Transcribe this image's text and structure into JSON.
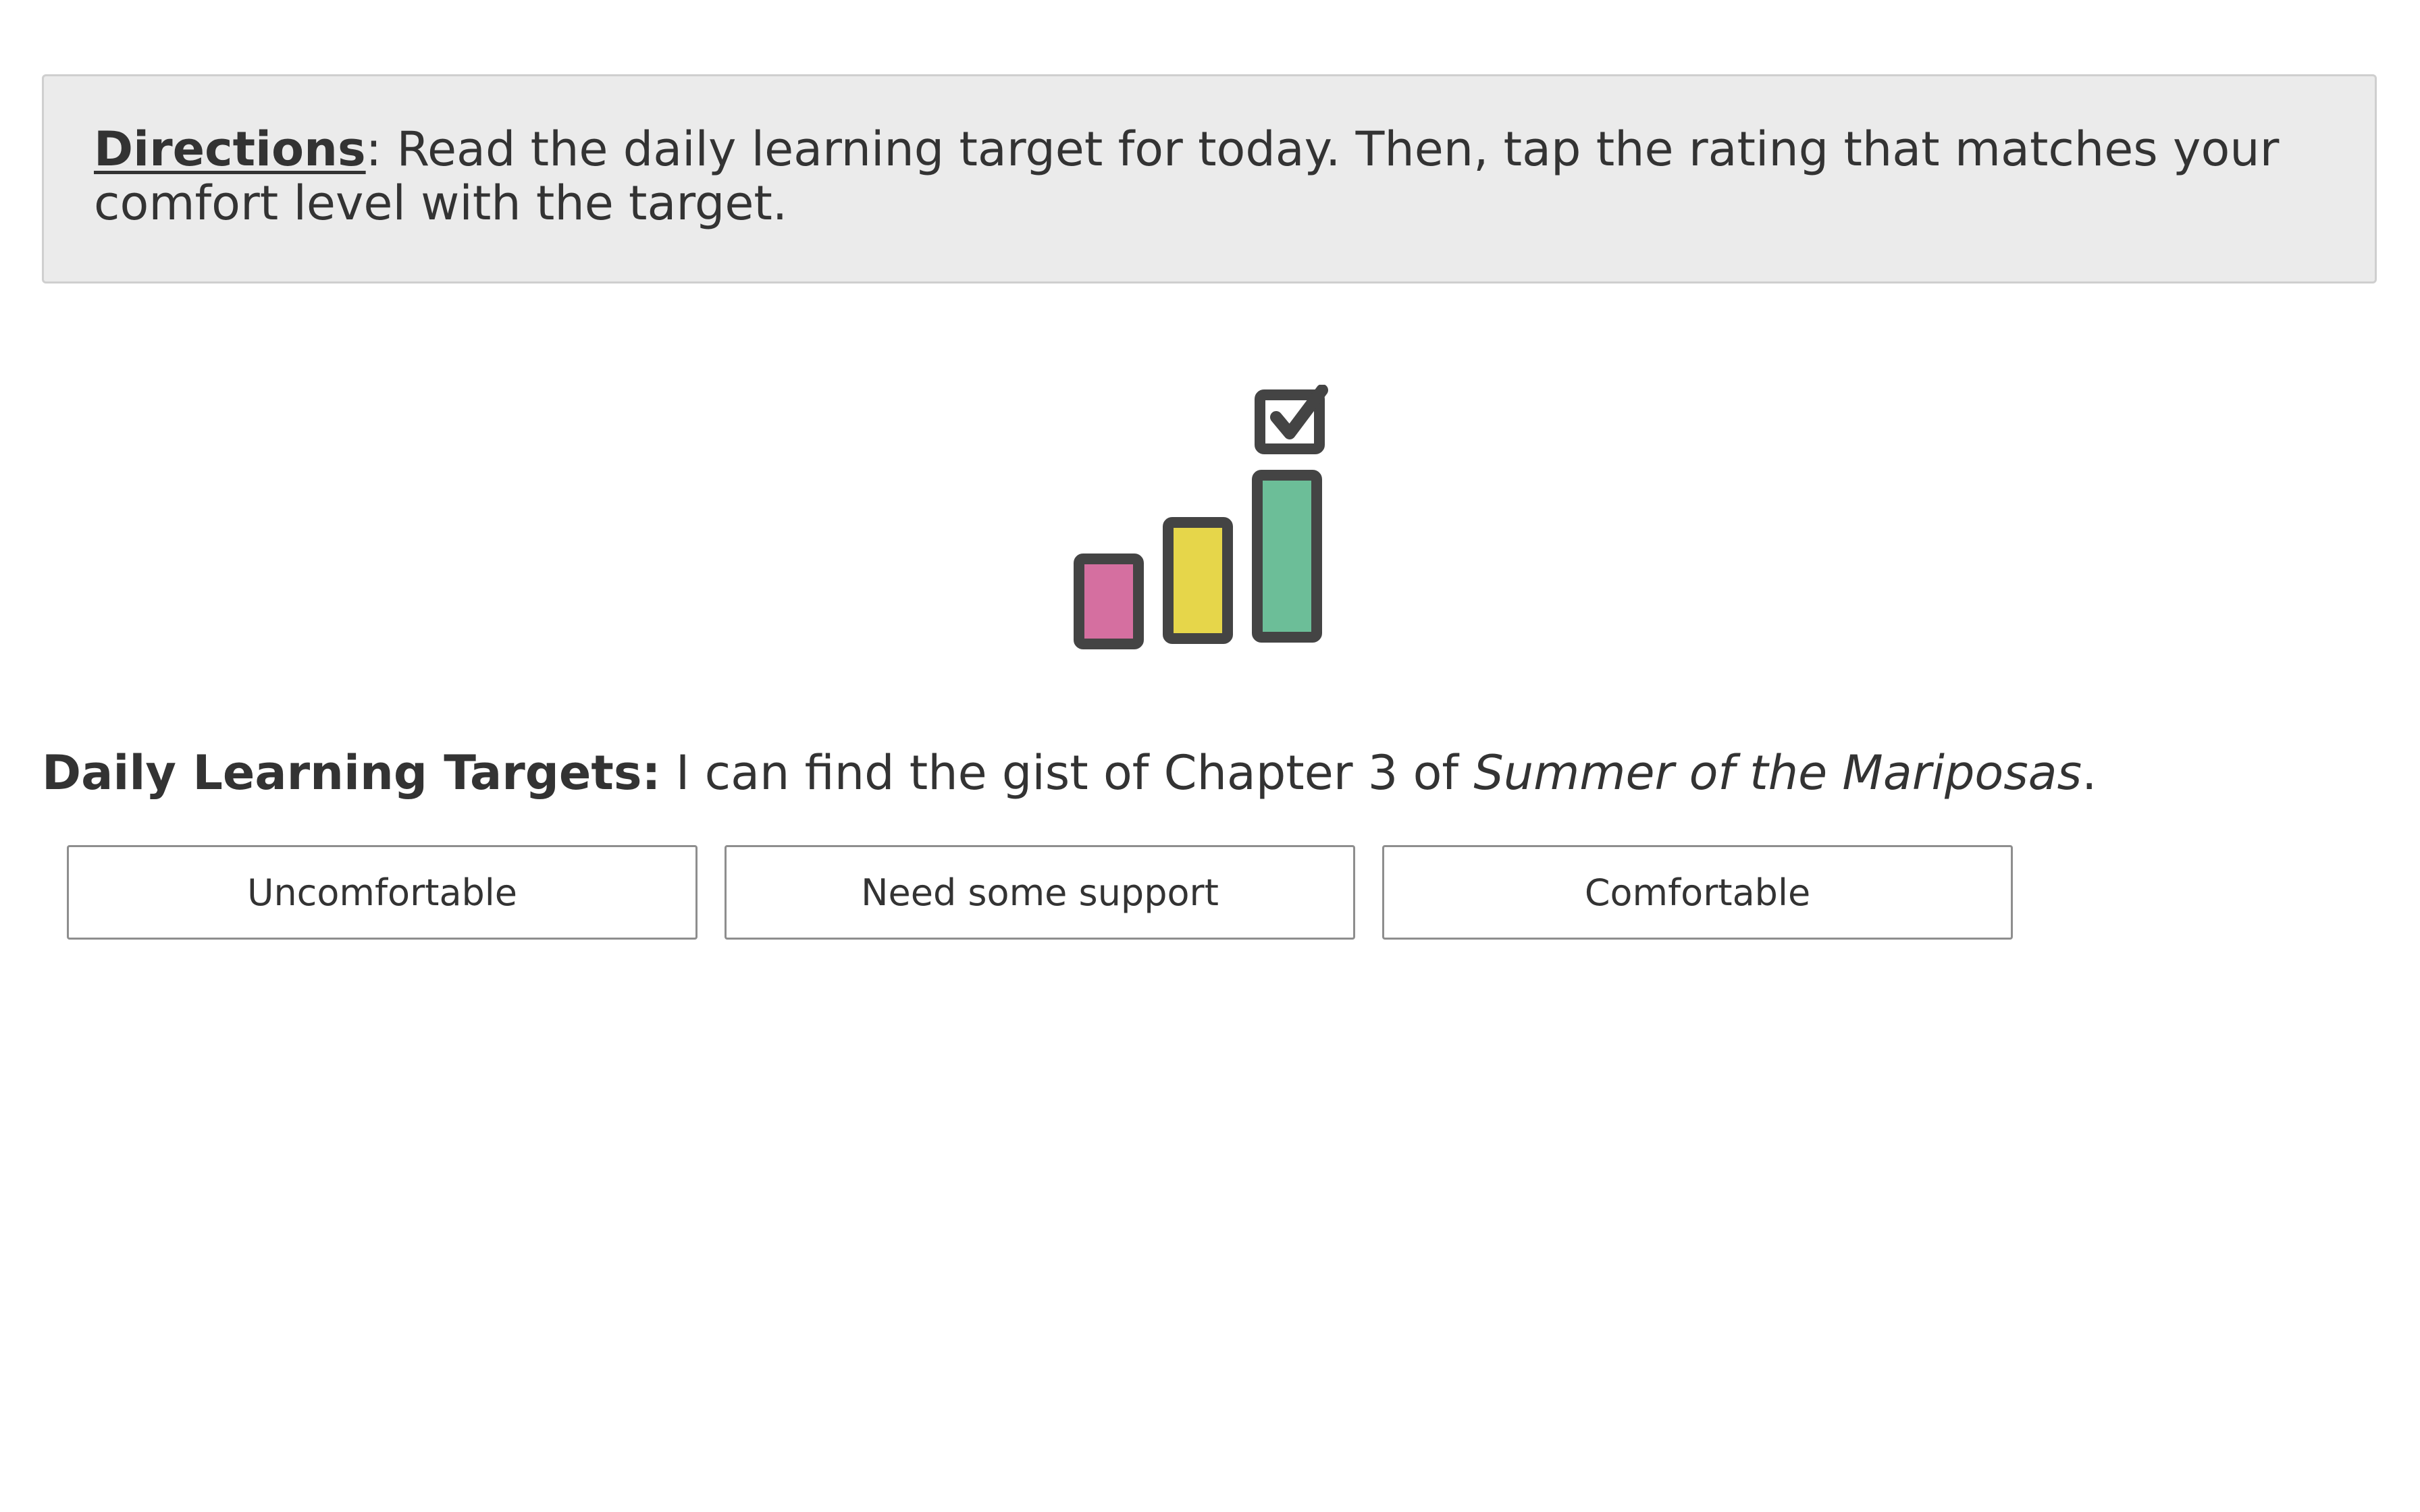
{
  "directions": {
    "heading": "Directions",
    "separator": ":",
    "text": " Read the daily learning target for today. Then, tap the rating that matches your comfort level with the target."
  },
  "rating_icon": {
    "icon": "rating-bars-with-checkbox-icon",
    "colors": {
      "outline": "#444444",
      "low": "#d56fa0",
      "medium": "#e6d64a",
      "high": "#6cbe98"
    }
  },
  "learning_target": {
    "label": "Daily Learning Targets:",
    "text_before": " I can find the gist of Chapter 3 of ",
    "book_title": "Summer of the Mariposas",
    "text_after": "."
  },
  "ratings": [
    {
      "label": "Uncomfortable"
    },
    {
      "label": "Need some support"
    },
    {
      "label": "Comfortable"
    }
  ]
}
